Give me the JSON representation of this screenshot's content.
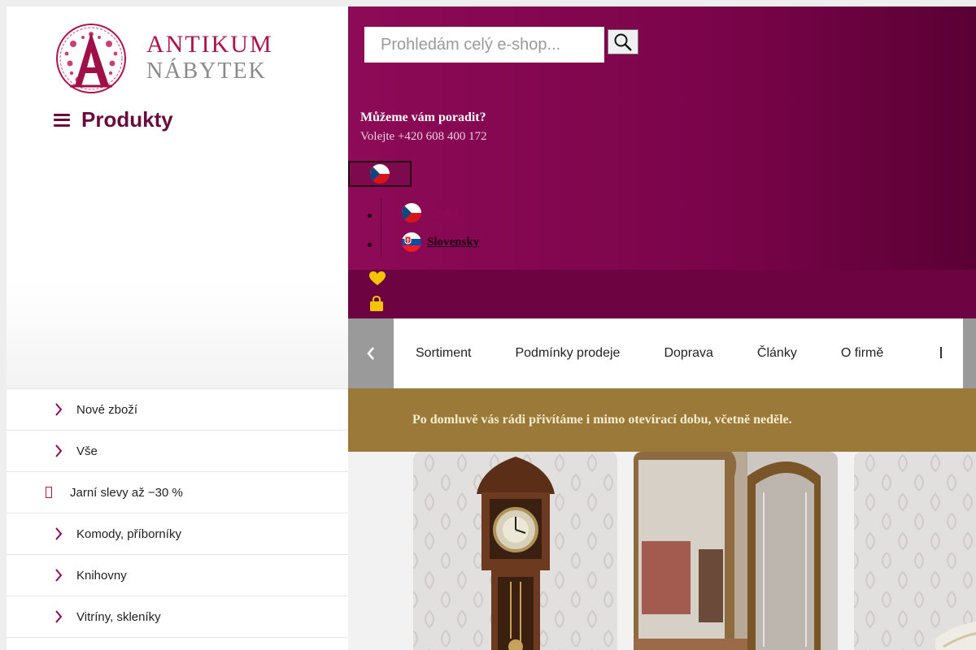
{
  "brand": {
    "name_line1": "ANTIKUM",
    "name_line2": "NÁBYTEK",
    "accent_color": "#b0124f"
  },
  "menu_toggle": {
    "label": "Produkty",
    "icon": "hamburger-icon"
  },
  "search": {
    "placeholder": "Prohledám celý e-shop...",
    "value": ""
  },
  "contact": {
    "question": "Můžeme vám poradit?",
    "call": "Volejte +420 608 400 172"
  },
  "languages": {
    "current_flag": "czech-flag-icon",
    "items": [
      {
        "name": "Česky",
        "flag": "czech-flag-icon"
      },
      {
        "name": "Slovensky",
        "flag": "slovak-flag-icon"
      }
    ]
  },
  "header_icons": [
    "heart-icon",
    "shopping-bag-icon"
  ],
  "nav": {
    "items": [
      "Sortiment",
      "Podmínky prodeje",
      "Doprava",
      "Články",
      "O firmě"
    ]
  },
  "banner": {
    "text": "Po domluvě vás rádi přivítáme i mimo otevírací dobu, včetně neděle."
  },
  "categories": [
    {
      "label": "Nové zboží",
      "icon": "chevron-right-icon"
    },
    {
      "label": "Vše",
      "icon": "chevron-right-icon"
    },
    {
      "label": "Jarní slevy až −30 %",
      "icon": "missing-glyph-icon"
    },
    {
      "label": "Komody, příborníky",
      "icon": "chevron-right-icon"
    },
    {
      "label": "Knihovny",
      "icon": "chevron-right-icon"
    },
    {
      "label": "Vitríny, skleníky",
      "icon": "chevron-right-icon"
    }
  ],
  "colors": {
    "header_magenta": "#8d0a57",
    "banner_gold": "#9b7a39",
    "heart_yellow": "#f5c400"
  }
}
